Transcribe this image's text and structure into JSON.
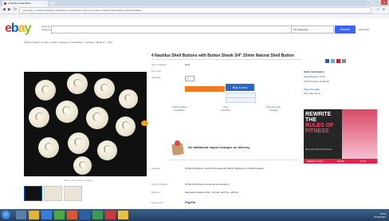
{
  "browser": {
    "tab_title": "4 Nautilus Shell Butto...",
    "tab_close": "×",
    "url": "www.ebay.co.uk/itm/4-Nautilus-Shell-Buttons-with-Button-Shank-3-4-20mm-Natural-Shell-Button-/321023438192",
    "window_min": "–",
    "window_max": "□",
    "window_close": "×"
  },
  "header": {
    "shop_by": "Shop by category",
    "search_button": "Search",
    "advanced": "Advanced",
    "category_label": "All Categories",
    "breadcrumb": "Back to search results | Listed in category: Collectables > Sewing > Buttons > Shell"
  },
  "item": {
    "title": "4 Nautilus Shell Buttons with Button Shank 3/4\" 20mm Natural Shell Button",
    "condition_label": "Item condition:",
    "condition_value": "New",
    "time_label": "Time left:",
    "quantity_label": "Quantity:",
    "quantity_value": "1",
    "buy_now": "Buy it now",
    "stats": [
      {
        "value": "100% positive",
        "label": "Feedback"
      },
      {
        "value": "New",
        "label": "Condition"
      },
      {
        "value": "Fast and safe",
        "label": "Postage"
      }
    ],
    "no_import": "No additional import charges on delivery",
    "hover_text": "Mouse over image to zoom",
    "postage_label": "Postage:",
    "postage_value": "US $9.99 (approx. £6.23) International Priority Shipping to United Kingdom",
    "import_label": "Import charges:",
    "import_value": "US $0.00 (amount confirmed at checkout)",
    "delivery_label": "Delivery:",
    "delivery_value": "Estimated between Mon. 10 Feb. and Tue. 18 Feb.",
    "payments_label": "Payments:",
    "payments_value": "PayPal"
  },
  "seller": {
    "heading": "Seller information",
    "name": "beautybuttons (713)",
    "positive": "100% Positive feedback",
    "save_seller": "Save this seller",
    "see_items": "See other items"
  },
  "ad": {
    "line1": "REWRITE",
    "line2": "THE",
    "line3": "RULES OF",
    "line4": "FITNESS",
    "sub": "Discover Reebok Fitness",
    "cta1": "CHECK IT OUT",
    "cta2": "MORE",
    "cta3": "FIT IN"
  },
  "taskbar": {
    "time": "16:34",
    "date": "07/02/2014"
  },
  "colors": {
    "ebay_red": "#e53238",
    "ebay_blue": "#0064d2",
    "ebay_yellow": "#f5af02",
    "ebay_green": "#86b817",
    "buy_blue": "#2c67c4"
  }
}
